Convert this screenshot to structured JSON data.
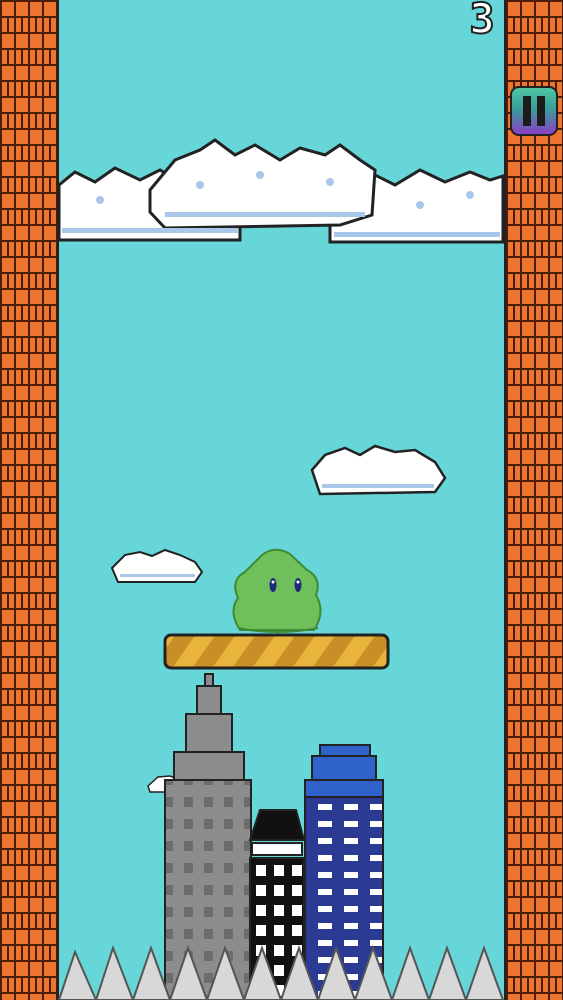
{
  "hud": {
    "score": "3",
    "pause_icon": "pause-icon"
  },
  "colors": {
    "sky": "#67d6d8",
    "brick": "#ee7530",
    "platform": "#e3b13d",
    "slime": "#6fc05a"
  }
}
